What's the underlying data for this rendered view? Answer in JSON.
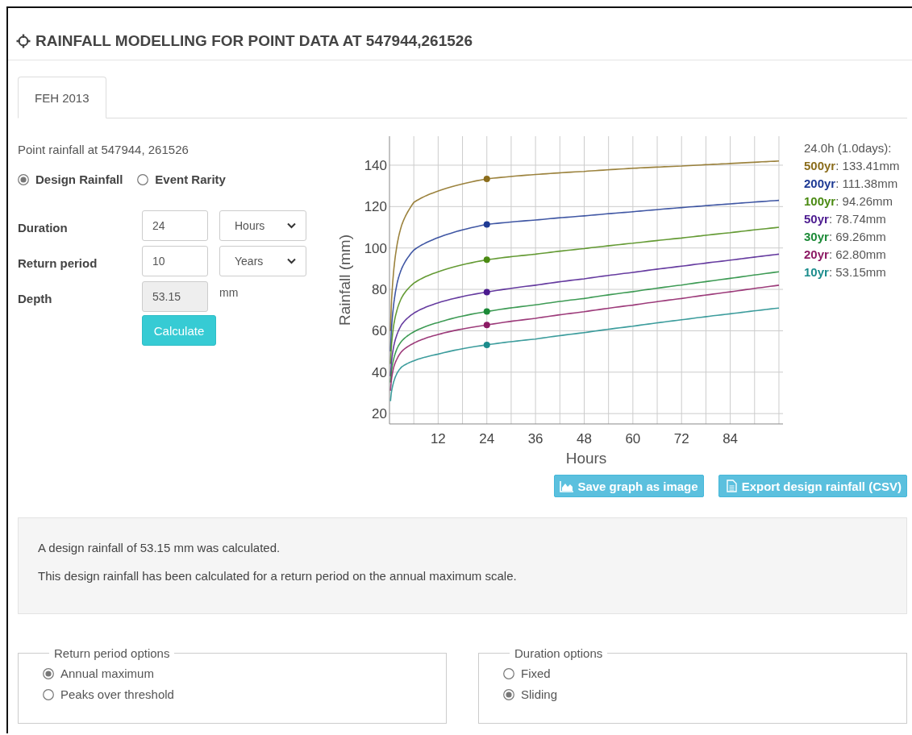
{
  "header": {
    "title": "RAINFALL MODELLING FOR POINT DATA AT 547944,261526"
  },
  "tabs": [
    {
      "label": "FEH 2013",
      "selected": true
    }
  ],
  "form": {
    "location": "Point rainfall at 547944, 261526",
    "modes": [
      {
        "label": "Design Rainfall",
        "selected": true
      },
      {
        "label": "Event Rarity",
        "selected": false
      }
    ],
    "rows": [
      {
        "kind": "input",
        "label": "Duration",
        "value": "24",
        "unit_select": "Hours"
      },
      {
        "kind": "input",
        "label": "Return period",
        "value": "10",
        "unit_select": "Years"
      },
      {
        "kind": "output",
        "label": "Depth",
        "value": "53.15",
        "unit": "mm",
        "disabled": true
      }
    ],
    "calculate_button": "Calculate"
  },
  "chart": {
    "chart_data": {
      "type": "line",
      "xlabel": "Hours",
      "ylabel": "Rainfall (mm)",
      "x": [
        0.25,
        1,
        2,
        3,
        6,
        12,
        24,
        36,
        48,
        60,
        72,
        84,
        96
      ],
      "xlim": [
        0,
        97
      ],
      "ylim": [
        15,
        154
      ],
      "xticks": [
        12,
        24,
        36,
        48,
        60,
        72,
        84
      ],
      "yticks": [
        20,
        40,
        60,
        80,
        100,
        120,
        140
      ],
      "series": [
        {
          "name": "500yr",
          "color": "#8b6d1c",
          "values": [
            60,
            88,
            103,
            111,
            122,
            127.5,
            133.4,
            135.5,
            137,
            138.5,
            139.6,
            140.8,
            142
          ]
        },
        {
          "name": "200yr",
          "color": "#1e3a94",
          "values": [
            50,
            72,
            84,
            90,
            99,
            105,
            111.4,
            113.5,
            115.5,
            117.5,
            119.5,
            121.3,
            123
          ]
        },
        {
          "name": "100yr",
          "color": "#4a8a12",
          "values": [
            44,
            62,
            71,
            76,
            83,
            88.5,
            94.3,
            97,
            99.7,
            102.3,
            104.8,
            107.4,
            110
          ]
        },
        {
          "name": "50yr",
          "color": "#4b1a8f",
          "values": [
            38,
            52,
            59,
            63,
            68.5,
            73.5,
            78.7,
            82,
            85.1,
            88.2,
            91.2,
            94.1,
            97
          ]
        },
        {
          "name": "30yr",
          "color": "#1c8a37",
          "values": [
            35,
            46,
            52,
            55,
            59.5,
            64,
            69.3,
            72.5,
            75.6,
            78.9,
            82.1,
            85.3,
            88.5
          ]
        },
        {
          "name": "20yr",
          "color": "#8c1a64",
          "values": [
            31,
            42,
            47,
            50,
            54,
            58.2,
            62.8,
            66,
            69.2,
            72.4,
            75.6,
            78.8,
            82
          ]
        },
        {
          "name": "10yr",
          "color": "#1b8c8c",
          "values": [
            26,
            35,
            40,
            42.5,
            45.5,
            48.7,
            53.2,
            56,
            59.1,
            62.2,
            65.3,
            68.2,
            71
          ]
        }
      ],
      "grid": true
    },
    "legend": {
      "title": "24.0h (1.0days):",
      "items": [
        {
          "value": ": 133.41mm"
        },
        {
          "value": ": 111.38mm"
        },
        {
          "value": ": 94.26mm"
        },
        {
          "value": ": 78.74mm"
        },
        {
          "value": ": 69.26mm"
        },
        {
          "value": ": 62.80mm"
        },
        {
          "value": ": 53.15mm"
        }
      ]
    },
    "buttons": [
      {
        "kind": "image",
        "label": "Save graph as image"
      },
      {
        "kind": "csv",
        "label": "Export design rainfall (CSV)"
      }
    ]
  },
  "result": {
    "lines": [
      "A design rainfall of 53.15 mm was calculated.",
      "This design rainfall has been calculated for a return period on the annual maximum scale."
    ]
  },
  "option_groups": [
    {
      "title": "Return period options",
      "options": [
        {
          "label": "Annual maximum",
          "selected": true
        },
        {
          "label": "Peaks over threshold",
          "selected": false
        }
      ]
    },
    {
      "title": "Duration options",
      "options": [
        {
          "label": "Fixed",
          "selected": false
        },
        {
          "label": "Sliding",
          "selected": true
        }
      ]
    }
  ]
}
